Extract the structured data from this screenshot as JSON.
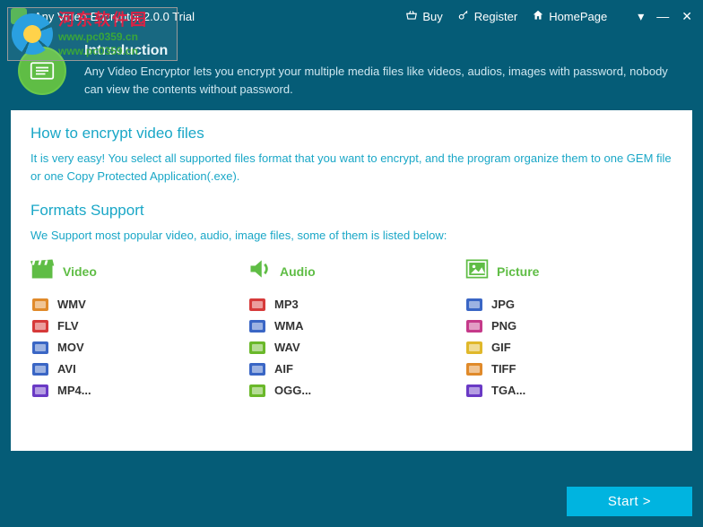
{
  "titlebar": {
    "title": "Any Video Encryptor 2.0.0 Trial",
    "buy": "Buy",
    "register": "Register",
    "homepage": "HomePage"
  },
  "watermark": {
    "cn": "河东软件园",
    "url1": "www.pc0359.cn",
    "url2": "www.pc0359.cn"
  },
  "intro": {
    "heading": "Introduction",
    "body": "Any Video Encryptor lets you encrypt your multiple media files like videos, audios, images with password, nobody can view the contents without password."
  },
  "howto": {
    "heading": "How to encrypt video files",
    "body": "It is very easy!  You select all supported files format that you want to encrypt, and the program organize them to one GEM file or one Copy Protected Application(.exe)."
  },
  "formats": {
    "heading": "Formats Support",
    "body": "We Support most popular video, audio, image files, some of them is listed below:",
    "columns": [
      {
        "key": "video",
        "label": "Video",
        "items": [
          {
            "name": "WMV",
            "color": "#e08a2a"
          },
          {
            "name": "FLV",
            "color": "#d63a3a"
          },
          {
            "name": "MOV",
            "color": "#3a66c5"
          },
          {
            "name": "AVI",
            "color": "#3a66c5"
          },
          {
            "name": "MP4...",
            "color": "#6a3ac5"
          }
        ]
      },
      {
        "key": "audio",
        "label": "Audio",
        "items": [
          {
            "name": "MP3",
            "color": "#d63a3a"
          },
          {
            "name": "WMA",
            "color": "#3a66c5"
          },
          {
            "name": "WAV",
            "color": "#6ab82a"
          },
          {
            "name": "AIF",
            "color": "#3a66c5"
          },
          {
            "name": "OGG...",
            "color": "#6ab82a"
          }
        ]
      },
      {
        "key": "picture",
        "label": "Picture",
        "items": [
          {
            "name": "JPG",
            "color": "#3a66c5"
          },
          {
            "name": "PNG",
            "color": "#c53a8a"
          },
          {
            "name": "GIF",
            "color": "#e0b82a"
          },
          {
            "name": "TIFF",
            "color": "#e08a2a"
          },
          {
            "name": "TGA...",
            "color": "#6a3ac5"
          }
        ]
      }
    ]
  },
  "actions": {
    "start": "Start >"
  }
}
